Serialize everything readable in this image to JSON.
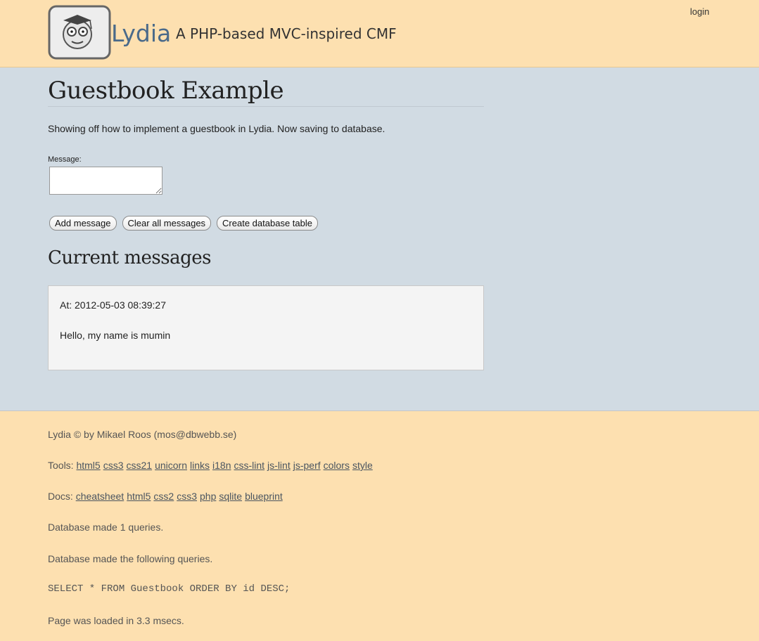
{
  "header": {
    "sitename": "Lydia",
    "slogan": "A PHP-based MVC-inspired CMF",
    "login": "login"
  },
  "main": {
    "title": "Guestbook Example",
    "intro": "Showing off how to implement a guestbook in Lydia. Now saving to database.",
    "form": {
      "message_label": "Message:",
      "message_value": "",
      "buttons": [
        "Add message",
        "Clear all messages",
        "Create database table"
      ]
    },
    "messages_heading": "Current messages",
    "messages": [
      {
        "at": "At: 2012-05-03 08:39:27",
        "text": "Hello, my name is mumin"
      }
    ]
  },
  "footer": {
    "credit": "Lydia © by Mikael Roos (mos@dbwebb.se)",
    "tools_label": "Tools:",
    "tools": [
      "html5",
      "css3",
      "css21",
      "unicorn",
      "links",
      "i18n",
      "css-lint",
      "js-lint",
      "js-perf",
      "colors",
      "style"
    ],
    "docs_label": "Docs:",
    "docs": [
      "cheatsheet",
      "html5",
      "css2",
      "css3",
      "php",
      "sqlite",
      "blueprint"
    ],
    "db_count": "Database made 1 queries.",
    "db_following": "Database made the following queries.",
    "query": "SELECT * FROM Guestbook ORDER BY id DESC;",
    "loadtime": "Page was loaded in 3.3 msecs."
  },
  "colors": {
    "header_bg": "#fde0b0",
    "main_bg": "#d1dbe3",
    "message_bg": "#f4f4f4",
    "sitename": "#4a6a8a"
  },
  "icons": {
    "logo": "lydia-owl-logo-icon"
  }
}
